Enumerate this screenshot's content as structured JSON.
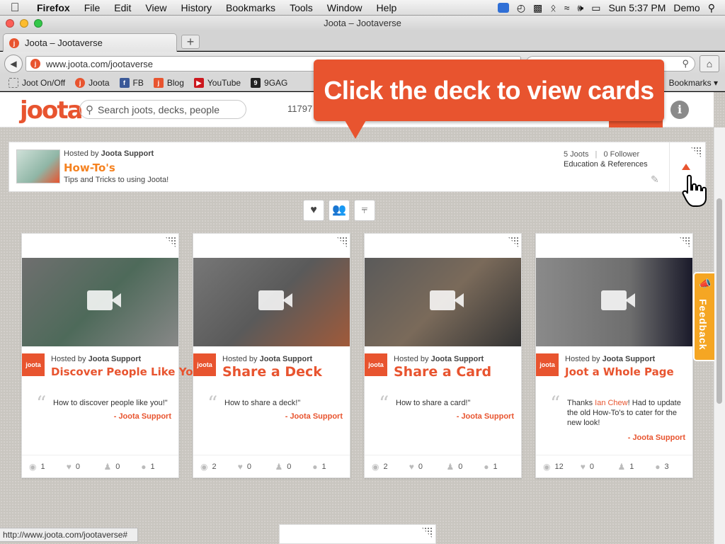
{
  "menubar": {
    "app": "Firefox",
    "items": [
      "File",
      "Edit",
      "View",
      "History",
      "Bookmarks",
      "Tools",
      "Window",
      "Help"
    ],
    "clock": "Sun 5:37 PM",
    "user": "Demo"
  },
  "window": {
    "title": "Joota – Jootaverse"
  },
  "tabs": [
    {
      "label": "Joota – Jootaverse"
    }
  ],
  "tab_new_label": "+",
  "url": "www.joota.com/jootaverse",
  "bookmarks": [
    {
      "label": "Joot On/Off",
      "icon": "dotted-square-icon"
    },
    {
      "label": "Joota",
      "icon": "joota-icon"
    },
    {
      "label": "FB",
      "icon": "facebook-icon"
    },
    {
      "label": "Blog",
      "icon": "blog-icon"
    },
    {
      "label": "YouTube",
      "icon": "youtube-icon"
    },
    {
      "label": "9GAG",
      "icon": "ninegag-icon"
    }
  ],
  "bookmarks_menu": "Bookmarks",
  "site": {
    "logo": "joota",
    "search_placeholder": "Search joots, decks, people",
    "count": "11797",
    "info_label": "i"
  },
  "deck": {
    "host_prefix": "Hosted by ",
    "host": "Joota Support",
    "title": "How-To's",
    "description": "Tips and Tricks to using Joota!",
    "joots": "5 Joots",
    "followers": "0 Follower",
    "category": "Education & References"
  },
  "tooltip": "Click the deck to view cards",
  "cards": [
    {
      "host": "Joota Support",
      "title": "Discover People Like You",
      "quote": "How to discover people like you!\"",
      "author": "- Joota Support",
      "views": "1",
      "likes": "0",
      "follows": "0",
      "comments": "1"
    },
    {
      "host": "Joota Support",
      "title": "Share a Deck",
      "quote": "How to share a deck!\"",
      "author": "- Joota Support",
      "views": "2",
      "likes": "0",
      "follows": "0",
      "comments": "1"
    },
    {
      "host": "Joota Support",
      "title": "Share a Card",
      "quote": "How to share a card!\"",
      "author": "- Joota Support",
      "views": "2",
      "likes": "0",
      "follows": "0",
      "comments": "1"
    },
    {
      "host": "Joota Support",
      "title": "Joot a Whole Page",
      "quote_pre": "Thanks ",
      "quote_mention": "Ian Chew",
      "quote_post": "! Had to update the old How-To's to cater for the new look!",
      "author": "- Joota Support",
      "views": "12",
      "likes": "0",
      "follows": "1",
      "comments": "3"
    }
  ],
  "card_host_prefix": "Hosted by ",
  "card_badge": "joota",
  "feedback": "Feedback",
  "statusbar": "http://www.joota.com/jootaverse#",
  "colors": {
    "brand": "#e8542f",
    "deck_title": "#f58220",
    "feedback": "#f5a623"
  }
}
